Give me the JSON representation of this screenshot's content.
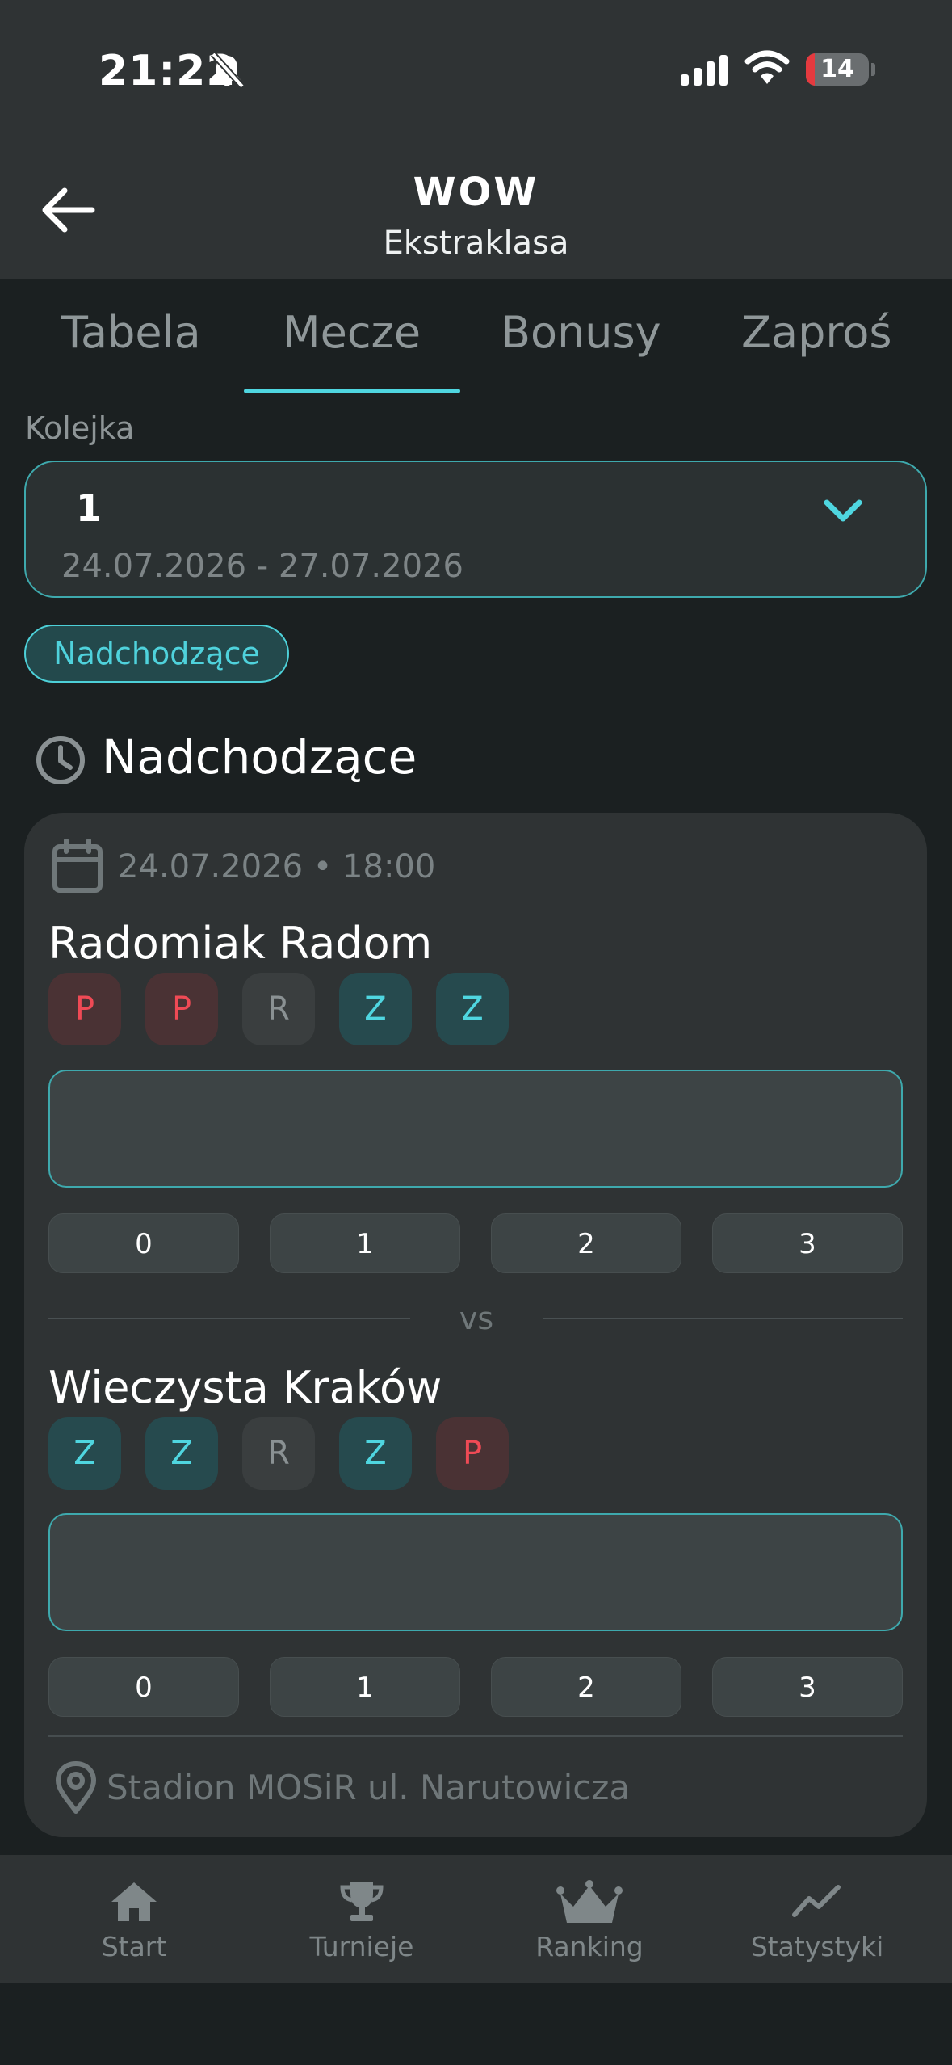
{
  "status_bar": {
    "time": "21:22",
    "battery": "14",
    "battery_level_percent": 14
  },
  "header": {
    "title": "WOW",
    "subtitle": "Ekstraklasa"
  },
  "tabs": [
    {
      "label": "Tabela",
      "active": false
    },
    {
      "label": "Mecze",
      "active": true
    },
    {
      "label": "Bonusy",
      "active": false
    },
    {
      "label": "Zaproś",
      "active": false
    }
  ],
  "round_selector": {
    "label": "Kolejka",
    "value": "1",
    "dates": "24.07.2026 - 27.07.2026"
  },
  "filter_chip": "Nadchodzące",
  "section_title": "Nadchodzące",
  "match": {
    "date": "24.07.2026 • 18:00",
    "home": {
      "name": "Radomiak Radom",
      "form": [
        "P",
        "P",
        "R",
        "Z",
        "Z"
      ],
      "score_value": "",
      "quick_scores": [
        "0",
        "1",
        "2",
        "3"
      ]
    },
    "vs": "vs",
    "away": {
      "name": "Wieczysta Kraków",
      "form": [
        "Z",
        "Z",
        "R",
        "Z",
        "P"
      ],
      "score_value": "",
      "quick_scores": [
        "0",
        "1",
        "2",
        "3"
      ]
    },
    "venue": "Stadion MOSiR ul. Narutowicza"
  },
  "bottom_nav": [
    {
      "label": "Start",
      "icon": "home-icon"
    },
    {
      "label": "Turnieje",
      "icon": "trophy-icon"
    },
    {
      "label": "Ranking",
      "icon": "crown-icon"
    },
    {
      "label": "Statystyki",
      "icon": "chart-line-icon"
    }
  ],
  "colors": {
    "accent": "#4fd6e0",
    "loss": "#ef4a55",
    "background": "#1b2021",
    "surface": "#2f3334"
  }
}
